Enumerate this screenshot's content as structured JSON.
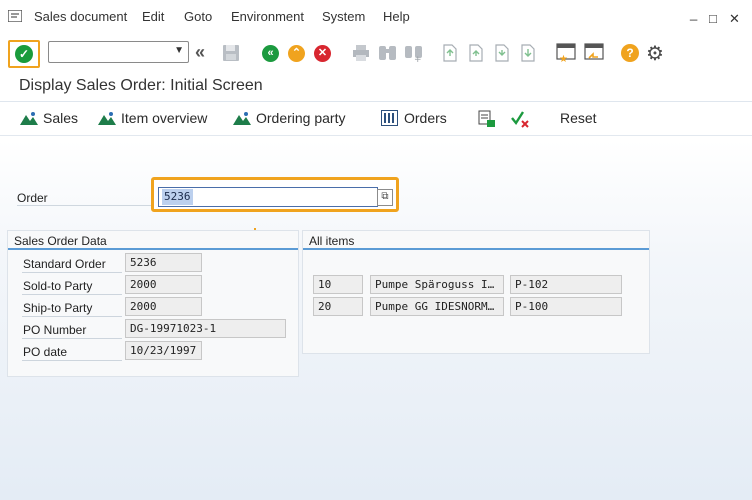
{
  "menu": {
    "items": [
      "Sales document",
      "Edit",
      "Goto",
      "Environment",
      "System",
      "Help"
    ],
    "window_controls": [
      "_",
      "□",
      "✕"
    ]
  },
  "toolbar": {
    "command_field_value": "",
    "accent_color": "#f0a31e"
  },
  "page": {
    "title": "Display Sales Order: Initial Screen"
  },
  "app_toolbar": {
    "sales": "Sales",
    "item_overview": "Item overview",
    "ordering_party": "Ordering party",
    "orders": "Orders",
    "reset": "Reset"
  },
  "order_field": {
    "label": "Order",
    "value": "5236"
  },
  "sales_order_data": {
    "title": "Sales Order Data",
    "rows": [
      {
        "label": "Standard Order",
        "value": "5236"
      },
      {
        "label": "Sold-to Party",
        "value": "2000"
      },
      {
        "label": "Ship-to Party",
        "value": "2000"
      },
      {
        "label": "PO Number",
        "value": "DG-19971023-1"
      },
      {
        "label": "PO date",
        "value": "10/23/1997"
      }
    ]
  },
  "all_items": {
    "title": "All items",
    "rows": [
      {
        "item": "10",
        "description": "Pumpe Späroguss I…",
        "material": "P-102"
      },
      {
        "item": "20",
        "description": "Pumpe GG IDESNORM…",
        "material": "P-100"
      }
    ]
  }
}
